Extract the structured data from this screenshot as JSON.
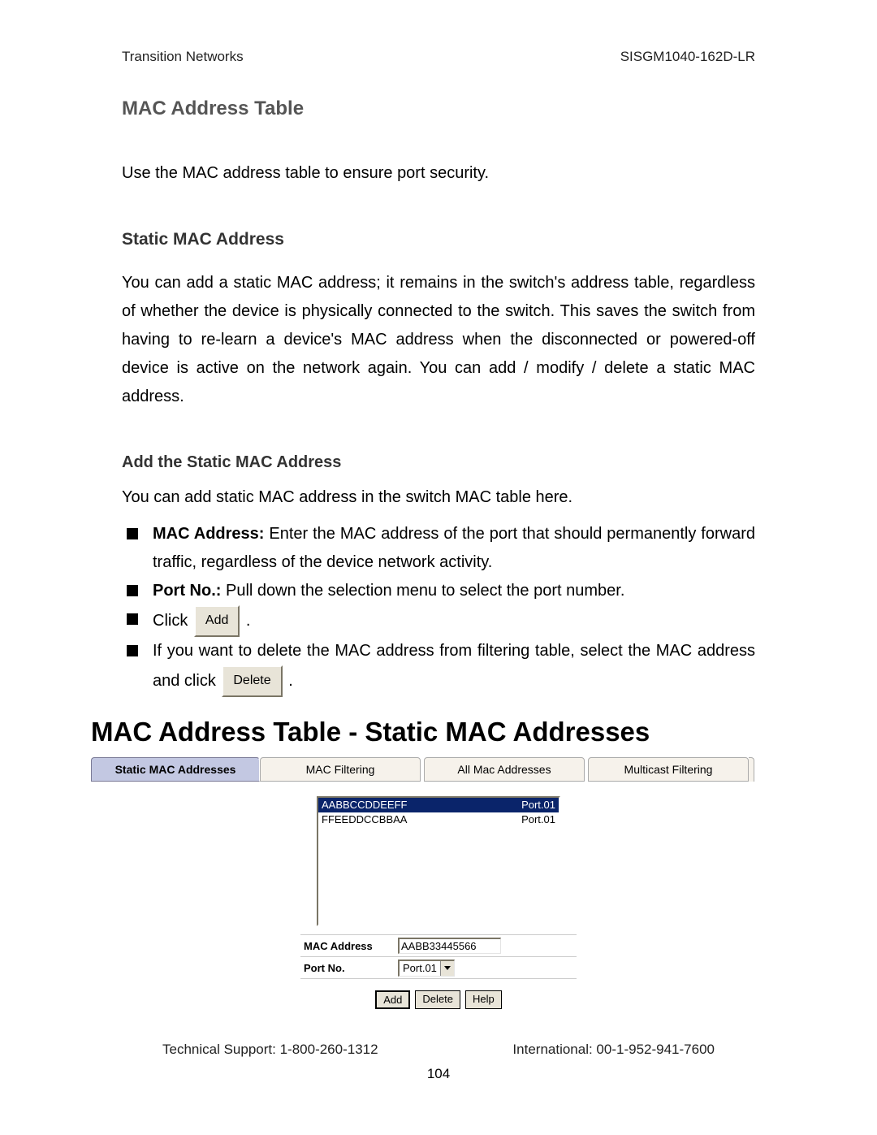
{
  "header": {
    "left": "Transition Networks",
    "right": "SISGM1040-162D-LR"
  },
  "footer": {
    "left": "Technical Support: 1-800-260-1312",
    "right": "International: 00-1-952-941-7600",
    "page": "104"
  },
  "sec1_title": "MAC Address Table",
  "sec1_para": "Use the MAC address table to ensure port security.",
  "sec2_title": "Static MAC Address",
  "sec2_para": "You can add a static MAC address; it remains in the switch's address table, regardless of whether the device is physically connected to the switch. This saves the switch from having to re-learn a device's MAC address when the disconnected or powered-off device is active on the network again. You can add / modify / delete a static MAC address.",
  "sec3_title": "Add the Static MAC Address",
  "sec3_intro": "You can add static MAC address in the switch MAC table here.",
  "b1_label": "MAC Address:",
  "b1_text": " Enter the MAC address of the port that should permanently forward traffic, regardless of the device network activity.",
  "b2_label": "Port No.:",
  "b2_text": " Pull down the selection menu to select the port number.",
  "b3_pre": "Click ",
  "b3_btn": "Add",
  "b3_post": " .",
  "b4_pre": "If you want to delete the MAC address from filtering table, select the MAC address and click ",
  "b4_btn": "Delete",
  "b4_post": " .",
  "shot": {
    "title": "MAC Address Table - Static MAC Addresses",
    "tabs": [
      "Static MAC Addresses",
      "MAC Filtering",
      "All Mac Addresses",
      "Multicast Filtering"
    ],
    "list": [
      {
        "mac": "AABBCCDDEEFF",
        "port": "Port.01",
        "selected": true
      },
      {
        "mac": "FFEEDDCCBBAA",
        "port": "Port.01",
        "selected": false
      }
    ],
    "form": {
      "mac_label": "MAC Address",
      "mac_value": "AABB33445566",
      "port_label": "Port No.",
      "port_value": "Port.01"
    },
    "buttons": {
      "add": "Add",
      "delete": "Delete",
      "help": "Help"
    }
  }
}
